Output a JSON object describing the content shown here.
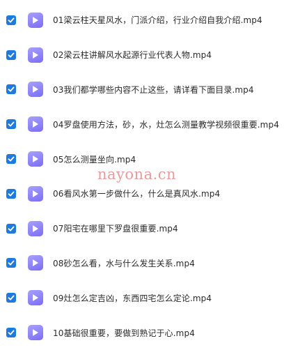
{
  "files": [
    {
      "name": "01梁云柱天星风水，门派介绍，行业介绍自我介绍.mp4",
      "checked": true
    },
    {
      "name": "02梁云柱讲解风水起源行业代表人物.mp4",
      "checked": true
    },
    {
      "name": "03我们都学哪些内容不止这些，请详看下面目录.mp4",
      "checked": true
    },
    {
      "name": "04罗盘使用方法，砂，水，灶怎么测量教学视频很重要.mp4",
      "checked": true
    },
    {
      "name": "05怎么测量坐向.mp4",
      "checked": true
    },
    {
      "name": "06看风水第一步做什么，什么是真风水.mp4",
      "checked": true
    },
    {
      "name": "07阳宅在哪里下罗盘很重要.mp4",
      "checked": true
    },
    {
      "name": "08砂怎么看，水与什么发生关系.mp4",
      "checked": true
    },
    {
      "name": "09灶怎么定吉凶，东西四宅怎么定论.mp4",
      "checked": true
    },
    {
      "name": "10基础很重要，要做到熟记于心.mp4",
      "checked": true
    }
  ],
  "watermark": "nayona.cn",
  "colors": {
    "checkbox": "#1f7ae0",
    "file_icon": "#8b7ff8",
    "watermark": "#e07a7a"
  },
  "icons": {
    "checkbox": "check-icon",
    "file": "video-file-icon"
  }
}
